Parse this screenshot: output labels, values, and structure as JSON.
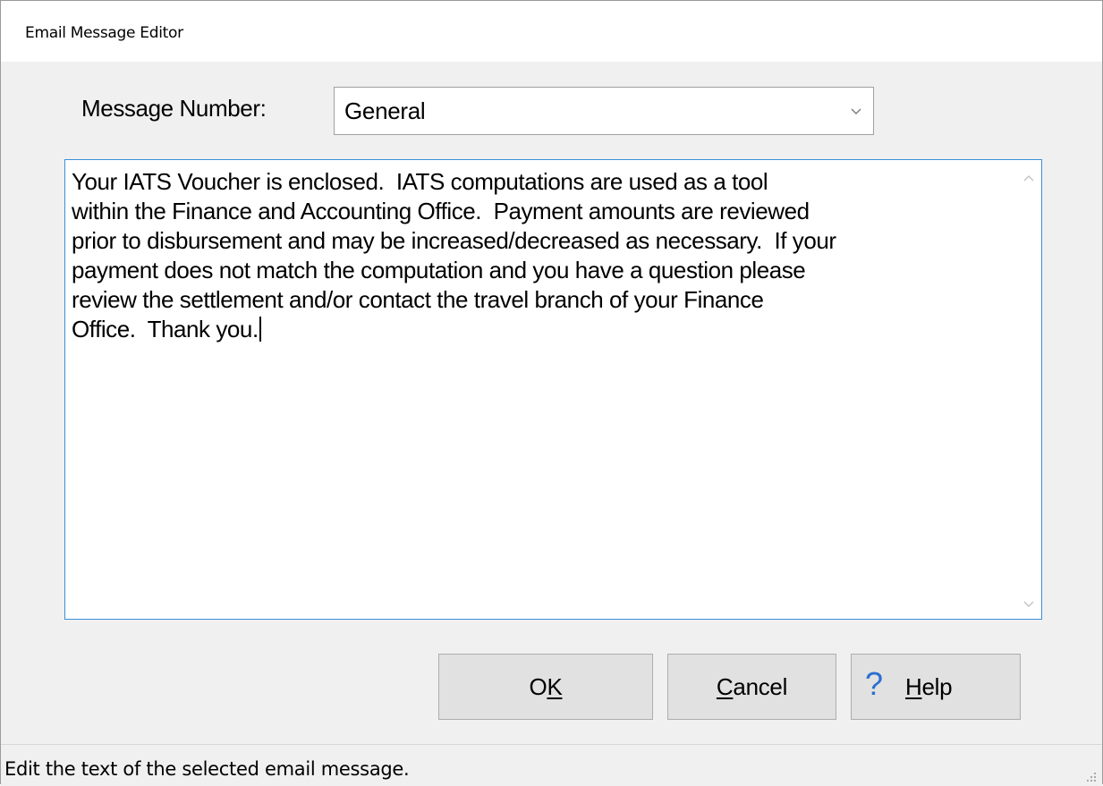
{
  "window": {
    "title": "Email Message Editor"
  },
  "form": {
    "message_number_label": "Message Number:",
    "message_number_value": "General",
    "message_text": "Your IATS Voucher is enclosed.  IATS computations are used as a tool\nwithin the Finance and Accounting Office.  Payment amounts are reviewed\nprior to disbursement and may be increased/decreased as necessary.  If your\npayment does not match the computation and you have a question please\nreview the settlement and/or contact the travel branch of your Finance\nOffice.  Thank you."
  },
  "buttons": {
    "ok_pre": "O",
    "ok_accel": "K",
    "cancel_accel": "C",
    "cancel_rest": "ancel",
    "help_icon": "?",
    "help_accel": "H",
    "help_rest": "elp"
  },
  "status": {
    "text": "Edit the text of the selected email message."
  },
  "icons": {
    "dropdown": "chevron-down-icon",
    "scroll_up": "chevron-up-icon",
    "scroll_down": "chevron-down-icon",
    "help": "question-mark-icon",
    "resize_grip": "resize-grip-icon"
  },
  "colors": {
    "focus_border": "#3c8fd6",
    "help_icon": "#2a6fd1",
    "window_bg": "#f0f0f0"
  }
}
